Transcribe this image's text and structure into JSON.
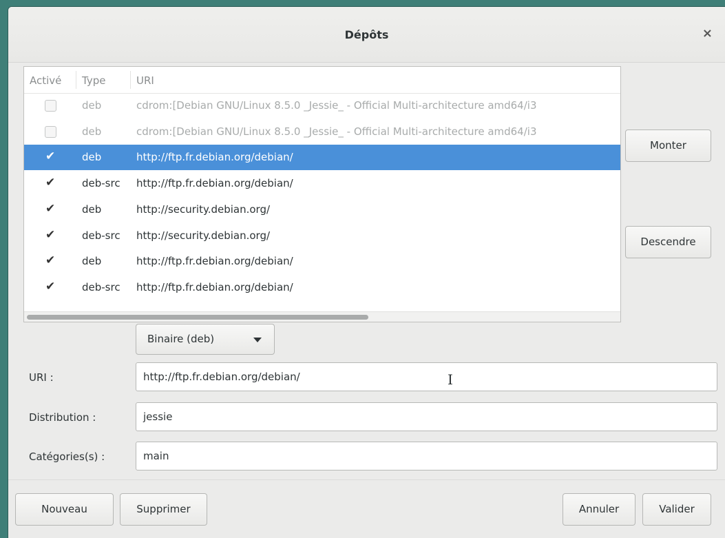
{
  "window": {
    "title": "Dépôts",
    "close_glyph": "×"
  },
  "table": {
    "columns": [
      "Activé",
      "Type",
      "URI"
    ],
    "rows": [
      {
        "enabled": false,
        "disabled": true,
        "selected": false,
        "type": "deb",
        "uri": "cdrom:[Debian GNU/Linux 8.5.0 _Jessie_ - Official Multi-architecture amd64/i3"
      },
      {
        "enabled": false,
        "disabled": true,
        "selected": false,
        "type": "deb",
        "uri": "cdrom:[Debian GNU/Linux 8.5.0 _Jessie_ - Official Multi-architecture amd64/i3"
      },
      {
        "enabled": true,
        "disabled": false,
        "selected": true,
        "type": "deb",
        "uri": "http://ftp.fr.debian.org/debian/"
      },
      {
        "enabled": true,
        "disabled": false,
        "selected": false,
        "type": "deb-src",
        "uri": "http://ftp.fr.debian.org/debian/"
      },
      {
        "enabled": true,
        "disabled": false,
        "selected": false,
        "type": "deb",
        "uri": "http://security.debian.org/"
      },
      {
        "enabled": true,
        "disabled": false,
        "selected": false,
        "type": "deb-src",
        "uri": "http://security.debian.org/"
      },
      {
        "enabled": true,
        "disabled": false,
        "selected": false,
        "type": "deb",
        "uri": "http://ftp.fr.debian.org/debian/"
      },
      {
        "enabled": true,
        "disabled": false,
        "selected": false,
        "type": "deb-src",
        "uri": "http://ftp.fr.debian.org/debian/"
      }
    ]
  },
  "side_buttons": {
    "up": "Monter",
    "down": "Descendre"
  },
  "form": {
    "type_combo": "Binaire (deb)",
    "uri_label": "URI :",
    "uri_value": "http://ftp.fr.debian.org/debian/",
    "distribution_label": "Distribution :",
    "distribution_value": "jessie",
    "categories_label": "Catégories(s) :",
    "categories_value": "main"
  },
  "footer": {
    "new": "Nouveau",
    "delete": "Supprimer",
    "cancel": "Annuler",
    "ok": "Valider"
  },
  "colors": {
    "selection": "#4a90d9",
    "desktop": "#3f7f78"
  }
}
